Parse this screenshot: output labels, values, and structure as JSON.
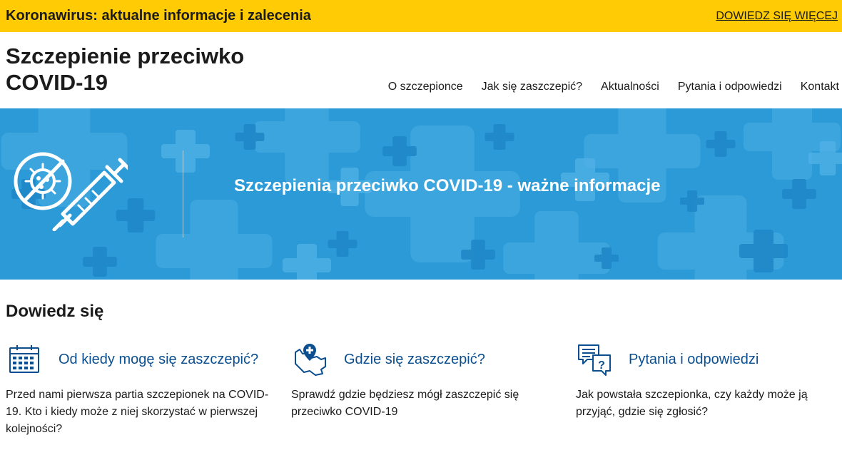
{
  "alert": {
    "title": "Koronawirus: aktualne informacje i zalecenia",
    "link": "DOWIEDZ SIĘ WIĘCEJ"
  },
  "header": {
    "title": "Szczepienie przeciwko COVID-19"
  },
  "nav": {
    "items": [
      {
        "label": "O szczepionce"
      },
      {
        "label": "Jak się zaszczepić?"
      },
      {
        "label": "Aktualności"
      },
      {
        "label": "Pytania i odpowiedzi"
      },
      {
        "label": "Kontakt"
      }
    ]
  },
  "hero": {
    "title": "Szczepienia przeciwko COVID-19 - ważne informacje",
    "icon": "vaccine-syringe-virus-icon"
  },
  "section": {
    "heading": "Dowiedz się",
    "cards": [
      {
        "icon": "calendar-icon",
        "title": "Od kiedy mogę się zaszczepić?",
        "text": "Przed nami pierwsza partia szczepionek na COVID-19. Kto i kiedy może z niej skorzystać w pierwszej kolejności?"
      },
      {
        "icon": "map-location-icon",
        "title": "Gdzie się zaszczepić?",
        "text": "Sprawdź gdzie będziesz mógł zaszczepić się przeciwko COVID-19"
      },
      {
        "icon": "questions-chat-icon",
        "title": "Pytania i odpowiedzi",
        "text": "Jak powstała szczepionka, czy każdy może ją przyjąć, gdzie się zgłosić?"
      }
    ]
  },
  "colors": {
    "alert_bg": "#ffcb05",
    "hero_bg": "#2b9ad6",
    "link": "#0b4f90"
  }
}
